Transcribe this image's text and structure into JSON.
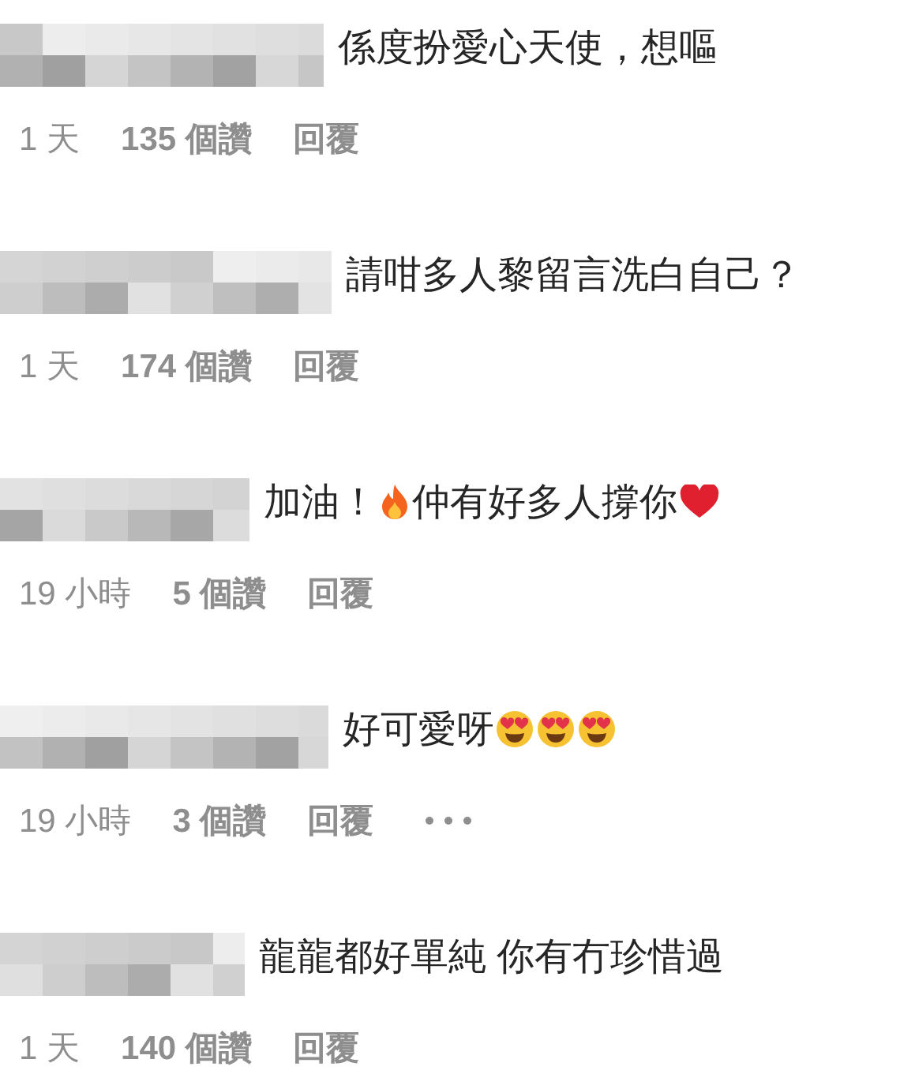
{
  "comments": [
    {
      "parts": [
        {
          "kind": "text",
          "text": "係度扮愛心天使，想嘔"
        }
      ],
      "time": "1 天",
      "likes": "135 個讚",
      "reply": "回覆",
      "more_button": false
    },
    {
      "parts": [
        {
          "kind": "text",
          "text": "請咁多人黎留言洗白自己？"
        }
      ],
      "time": "1 天",
      "likes": "174 個讚",
      "reply": "回覆",
      "more_button": false
    },
    {
      "parts": [
        {
          "kind": "text",
          "text": "加油！"
        },
        {
          "kind": "fire"
        },
        {
          "kind": "text",
          "text": "仲有好多人撐你"
        },
        {
          "kind": "heart"
        }
      ],
      "time": "19 小時",
      "likes": "5 個讚",
      "reply": "回覆",
      "more_button": false
    },
    {
      "parts": [
        {
          "kind": "text",
          "text": "好可愛呀"
        },
        {
          "kind": "heart-eyes"
        },
        {
          "kind": "heart-eyes"
        },
        {
          "kind": "heart-eyes"
        }
      ],
      "time": "19 小時",
      "likes": "3 個讚",
      "reply": "回覆",
      "more_button": true
    },
    {
      "parts": [
        {
          "kind": "text",
          "text": "龍龍都好單純 你有冇珍惜過"
        }
      ],
      "time": "1 天",
      "likes": "140 個讚",
      "reply": "回覆",
      "more_button": false
    }
  ]
}
